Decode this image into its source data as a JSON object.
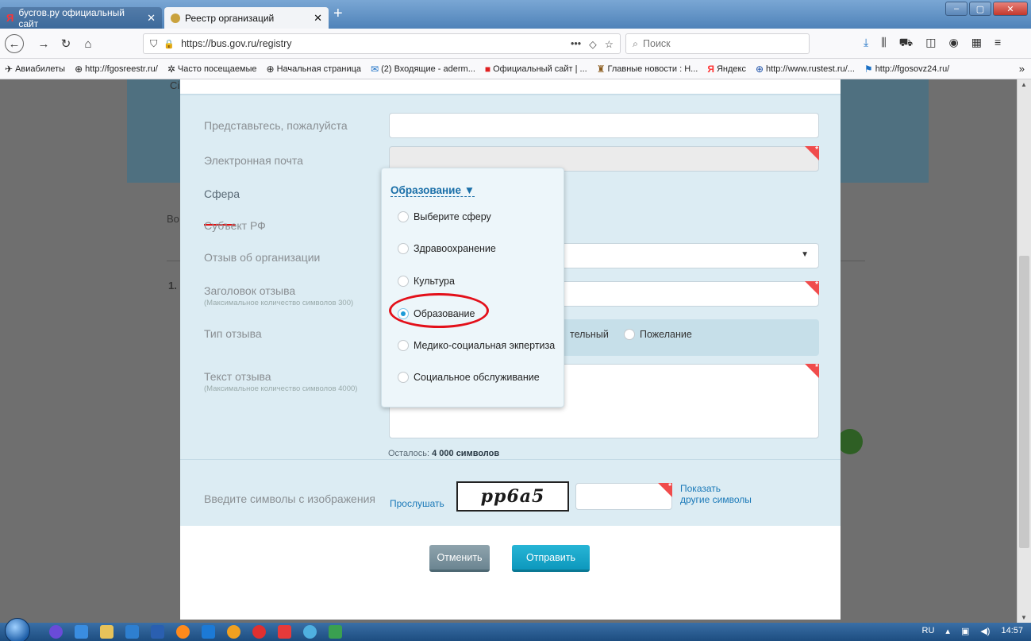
{
  "browser": {
    "tabs": [
      {
        "title": "бусгов.ру официальный сайт",
        "active": false,
        "favicon": "yandex-icon"
      },
      {
        "title": "Реестр организаций",
        "active": true,
        "favicon": "emblem-icon"
      }
    ],
    "url": "https://bus.gov.ru/registry",
    "search_placeholder": "Поиск",
    "bookmarks": [
      "Авиабилеты",
      "http://fgosreestr.ru/",
      "Часто посещаемые",
      "Начальная страница",
      "(2) Входящие - aderm...",
      "Официальный сайт | ...",
      "Главные новости : Н...",
      "Яндекс",
      "http://www.rustest.ru/...",
      "http://fgosovz24.ru/"
    ]
  },
  "background": {
    "fragment_cr": "Сі",
    "fragment_vo": "Во",
    "fragment_num": "1."
  },
  "form": {
    "name_label": "Представьтесь, пожалуйста",
    "email_label": "Электронная почта",
    "sphere_label": "Сфера",
    "region_label": "Субъект РФ",
    "org_review_label": "Отзыв об организации",
    "title_label": "Заголовок отзыва",
    "title_hint": "(Максимальное количество символов 300)",
    "type_label": "Тип отзыва",
    "type_options": [
      "тельный",
      "Пожелание"
    ],
    "text_label": "Текст отзыва",
    "text_hint": "(Максимальное количество символов 4000)",
    "remaining_prefix": "Осталось:",
    "remaining_value": "4 000 символов",
    "captcha_label": "Введите символы с изображения",
    "listen_link": "Прослушать",
    "captcha_text": "pp6a5",
    "other_symbols_line1": "Показать",
    "other_symbols_line2": "другие символы",
    "cancel_button": "Отменить",
    "submit_button": "Отправить"
  },
  "sphere_dropdown": {
    "selected": "Образование",
    "options": [
      {
        "label": "Выберите сферу",
        "checked": false
      },
      {
        "label": "Здравоохранение",
        "checked": false
      },
      {
        "label": "Культура",
        "checked": false
      },
      {
        "label": "Образование",
        "checked": true
      },
      {
        "label": "Медико-социальная экпертиза",
        "checked": false
      },
      {
        "label": "Социальное обслуживание",
        "checked": false
      }
    ]
  },
  "taskbar": {
    "lang": "RU",
    "time": "14:57"
  },
  "colors": {
    "accent": "#1d9bd7",
    "required": "#f04c4c",
    "annotation": "#e3101a",
    "form_bg": "#dcecf3"
  }
}
